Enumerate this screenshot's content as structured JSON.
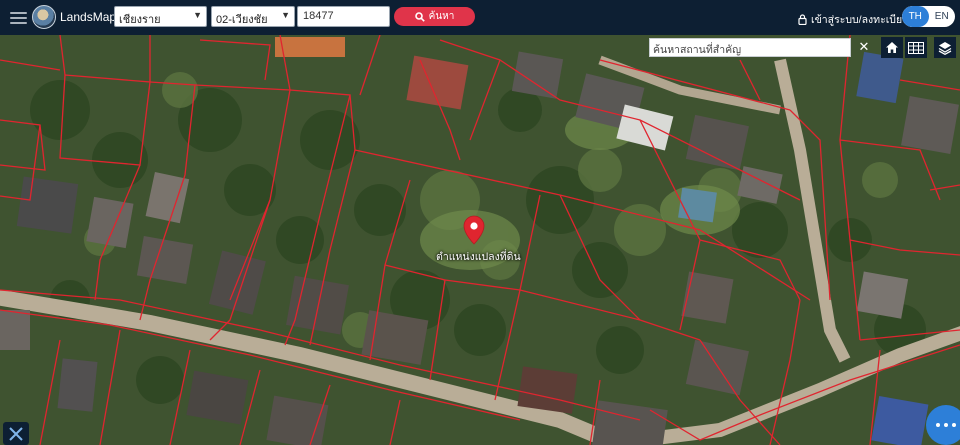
{
  "header": {
    "brand": "LandsMaps",
    "province_select": "เชียงราย",
    "district_select": "02-เวียงชัย",
    "parcel_input": "18477",
    "search_button": "ค้นหา",
    "login_link": "เข้าสู่ระบบ/ลงทะเบียน",
    "lang_th": "TH",
    "lang_en": "EN"
  },
  "map": {
    "place_search_placeholder": "ค้นหาสถานที่สำคัญ",
    "close_symbol": "✕",
    "marker_label": "ตำแหน่งแปลงที่ดิน"
  },
  "icons": [
    "menu-icon",
    "search-icon",
    "lock-icon",
    "home-icon",
    "grid-icon",
    "layers-icon",
    "map-marker-icon",
    "tools-icon",
    "chat-icon"
  ],
  "colors": {
    "topbar": "#0d1f33",
    "search_button": "#e0344a",
    "lang_active": "#2d7fd8",
    "parcel_lines": "#e0252f"
  }
}
